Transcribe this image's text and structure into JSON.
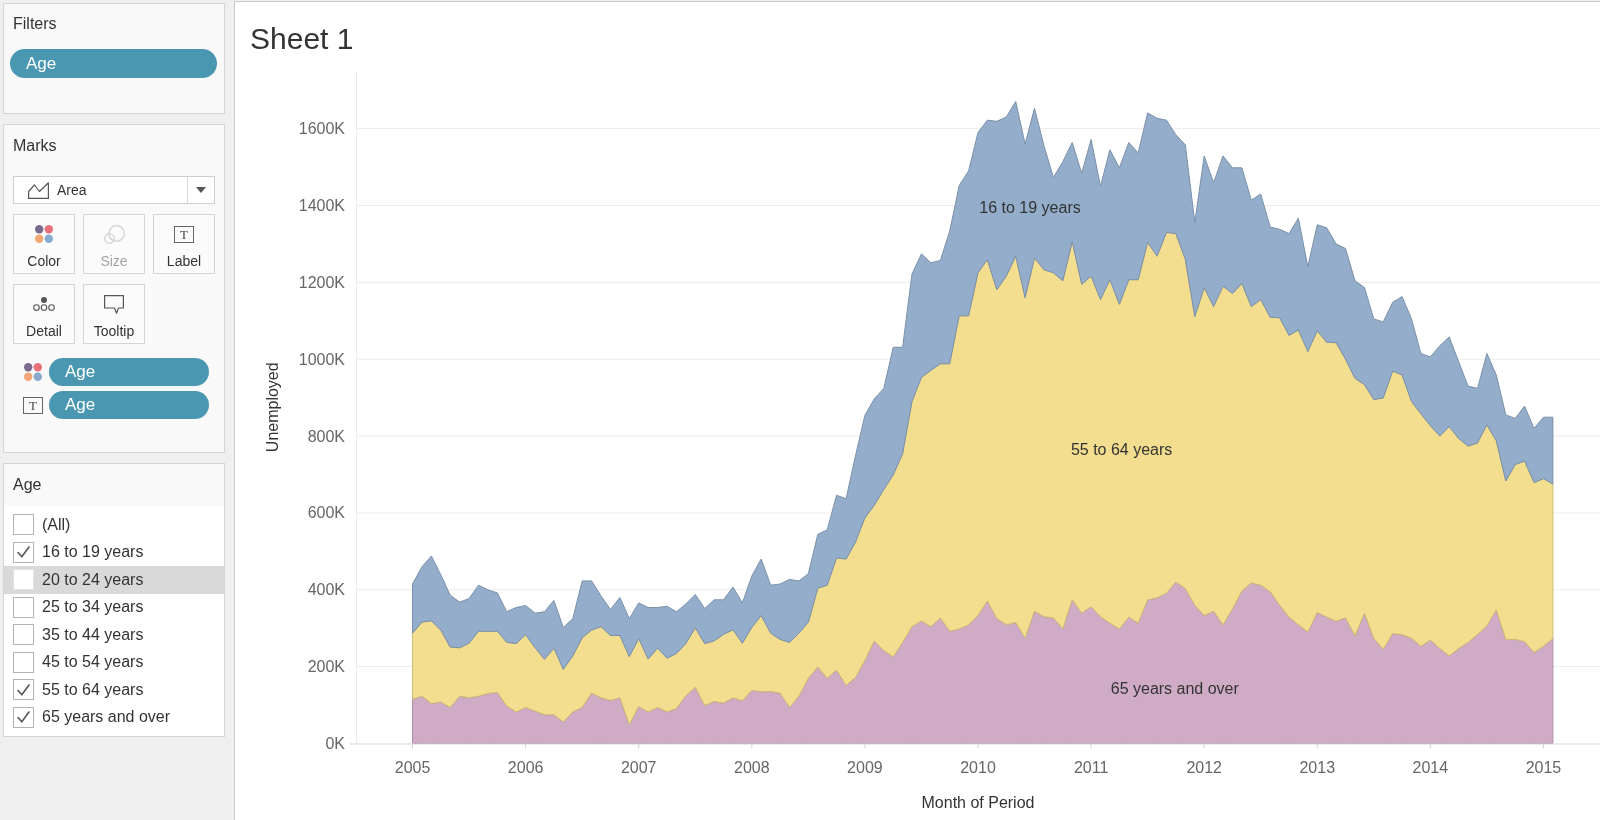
{
  "filters": {
    "title": "Filters",
    "pills": [
      {
        "label": "Age"
      }
    ]
  },
  "marks": {
    "title": "Marks",
    "mark_type": {
      "label": "Area"
    },
    "cards": [
      {
        "kind": "color",
        "label": "Color",
        "disabled": false
      },
      {
        "kind": "size",
        "label": "Size",
        "disabled": true
      },
      {
        "kind": "label",
        "label": "Label",
        "glyph": "T",
        "disabled": false
      },
      {
        "kind": "detail",
        "label": "Detail",
        "disabled": false
      },
      {
        "kind": "tooltip",
        "label": "Tooltip",
        "disabled": false
      }
    ],
    "fields": [
      {
        "kind": "color",
        "label": "Age"
      },
      {
        "kind": "label",
        "glyph": "T",
        "label": "Age"
      }
    ]
  },
  "age_filter": {
    "title": "Age",
    "items": [
      {
        "label": "(All)",
        "checked": false,
        "highlighted": false
      },
      {
        "label": "16 to 19 years",
        "checked": true,
        "highlighted": false
      },
      {
        "label": "20 to 24 years",
        "checked": false,
        "highlighted": true
      },
      {
        "label": "25 to 34 years",
        "checked": false,
        "highlighted": false
      },
      {
        "label": "35 to 44 years",
        "checked": false,
        "highlighted": false
      },
      {
        "label": "45 to 54 years",
        "checked": false,
        "highlighted": false
      },
      {
        "label": "55 to 64 years",
        "checked": true,
        "highlighted": false
      },
      {
        "label": "65 years and over",
        "checked": true,
        "highlighted": false
      }
    ]
  },
  "sheet": {
    "title": "Sheet 1",
    "chart_data": {
      "type": "area",
      "stacked": true,
      "grid": true,
      "xlabel": "Month of Period",
      "ylabel": "Unemployed",
      "x": [
        "2005-01",
        "2005-02",
        "2005-03",
        "2005-04",
        "2005-05",
        "2005-06",
        "2005-07",
        "2005-08",
        "2005-09",
        "2005-10",
        "2005-11",
        "2005-12",
        "2006-01",
        "2006-02",
        "2006-03",
        "2006-04",
        "2006-05",
        "2006-06",
        "2006-07",
        "2006-08",
        "2006-09",
        "2006-10",
        "2006-11",
        "2006-12",
        "2007-01",
        "2007-02",
        "2007-03",
        "2007-04",
        "2007-05",
        "2007-06",
        "2007-07",
        "2007-08",
        "2007-09",
        "2007-10",
        "2007-11",
        "2007-12",
        "2008-01",
        "2008-02",
        "2008-03",
        "2008-04",
        "2008-05",
        "2008-06",
        "2008-07",
        "2008-08",
        "2008-09",
        "2008-10",
        "2008-11",
        "2008-12",
        "2009-01",
        "2009-02",
        "2009-03",
        "2009-04",
        "2009-05",
        "2009-06",
        "2009-07",
        "2009-08",
        "2009-09",
        "2009-10",
        "2009-11",
        "2009-12",
        "2010-01",
        "2010-02",
        "2010-03",
        "2010-04",
        "2010-05",
        "2010-06",
        "2010-07",
        "2010-08",
        "2010-09",
        "2010-10",
        "2010-11",
        "2010-12",
        "2011-01",
        "2011-02",
        "2011-03",
        "2011-04",
        "2011-05",
        "2011-06",
        "2011-07",
        "2011-08",
        "2011-09",
        "2011-10",
        "2011-11",
        "2011-12",
        "2012-01",
        "2012-02",
        "2012-03",
        "2012-04",
        "2012-05",
        "2012-06",
        "2012-07",
        "2012-08",
        "2012-09",
        "2012-10",
        "2012-11",
        "2012-12",
        "2013-01",
        "2013-02",
        "2013-03",
        "2013-04",
        "2013-05",
        "2013-06",
        "2013-07",
        "2013-08",
        "2013-09",
        "2013-10",
        "2013-11",
        "2013-12",
        "2014-01",
        "2014-02",
        "2014-03",
        "2014-04",
        "2014-05",
        "2014-06",
        "2014-07",
        "2014-08",
        "2014-09",
        "2014-10",
        "2014-11",
        "2014-12",
        "2015-01",
        "2015-02"
      ],
      "xlim": [
        "2004-07",
        "2015-07"
      ],
      "ylim": [
        0,
        1750
      ],
      "xticks": [
        {
          "value": "2005-01",
          "label": "2005"
        },
        {
          "value": "2006-01",
          "label": "2006"
        },
        {
          "value": "2007-01",
          "label": "2007"
        },
        {
          "value": "2008-01",
          "label": "2008"
        },
        {
          "value": "2009-01",
          "label": "2009"
        },
        {
          "value": "2010-01",
          "label": "2010"
        },
        {
          "value": "2011-01",
          "label": "2011"
        },
        {
          "value": "2012-01",
          "label": "2012"
        },
        {
          "value": "2013-01",
          "label": "2013"
        },
        {
          "value": "2014-01",
          "label": "2014"
        },
        {
          "value": "2015-01",
          "label": "2015"
        }
      ],
      "yticks": [
        {
          "value": 0,
          "label": "0K"
        },
        {
          "value": 200,
          "label": "200K"
        },
        {
          "value": 400,
          "label": "400K"
        },
        {
          "value": 600,
          "label": "600K"
        },
        {
          "value": 800,
          "label": "800K"
        },
        {
          "value": 1000,
          "label": "1000K"
        },
        {
          "value": 1200,
          "label": "1200K"
        },
        {
          "value": 1400,
          "label": "1400K"
        },
        {
          "value": 1600,
          "label": "1600K"
        }
      ],
      "series": [
        {
          "name": "65 years and over",
          "color": "#cfabc6",
          "values": [
            115,
            123,
            104,
            108,
            94,
            123,
            119,
            123,
            130,
            133,
            97,
            82,
            94,
            84,
            75,
            75,
            56,
            82,
            94,
            131,
            119,
            112,
            119,
            49,
            96,
            82,
            94,
            82,
            91,
            124,
            146,
            99,
            109,
            105,
            119,
            111,
            138,
            135,
            135,
            131,
            94,
            123,
            170,
            199,
            170,
            191,
            151,
            172,
            216,
            267,
            242,
            225,
            263,
            304,
            319,
            304,
            327,
            292,
            298,
            309,
            333,
            371,
            325,
            309,
            315,
            274,
            344,
            330,
            327,
            298,
            374,
            339,
            356,
            330,
            313,
            298,
            329,
            313,
            374,
            379,
            391,
            420,
            403,
            360,
            333,
            344,
            309,
            350,
            397,
            418,
            412,
            395,
            360,
            329,
            309,
            290,
            341,
            329,
            318,
            327,
            280,
            339,
            274,
            245,
            286,
            283,
            274,
            253,
            269,
            247,
            228,
            247,
            263,
            283,
            306,
            348,
            271,
            271,
            265,
            237,
            253,
            273
          ]
        },
        {
          "name": "55 to 64 years",
          "color": "#f3dd8e",
          "values": [
            172,
            193,
            215,
            187,
            157,
            126,
            142,
            169,
            162,
            159,
            166,
            178,
            189,
            165,
            144,
            173,
            137,
            146,
            181,
            164,
            185,
            169,
            162,
            177,
            177,
            138,
            154,
            140,
            143,
            136,
            155,
            161,
            158,
            179,
            177,
            150,
            164,
            198,
            152,
            140,
            169,
            164,
            146,
            205,
            242,
            292,
            329,
            352,
            371,
            353,
            419,
            474,
            491,
            586,
            634,
            667,
            661,
            696,
            815,
            804,
            892,
            888,
            856,
            907,
            953,
            886,
            919,
            903,
            898,
            906,
            932,
            856,
            860,
            825,
            894,
            845,
            878,
            894,
            930,
            889,
            939,
            907,
            857,
            751,
            853,
            793,
            881,
            821,
            800,
            719,
            743,
            714,
            748,
            733,
            767,
            730,
            733,
            715,
            725,
            673,
            670,
            595,
            621,
            654,
            683,
            676,
            616,
            605,
            558,
            553,
            597,
            547,
            511,
            499,
            523,
            440,
            412,
            455,
            470,
            442,
            436,
            402
          ]
        },
        {
          "name": "16 to 19 years",
          "color": "#93adca",
          "values": [
            128,
            144,
            169,
            144,
            135,
            119,
            116,
            120,
            108,
            100,
            80,
            94,
            76,
            90,
            124,
            124,
            109,
            97,
            148,
            128,
            80,
            68,
            99,
            99,
            93,
            134,
            106,
            135,
            109,
            103,
            87,
            91,
            107,
            90,
            111,
            105,
            134,
            147,
            125,
            144,
            164,
            136,
            126,
            140,
            144,
            163,
            157,
            225,
            267,
            277,
            263,
            332,
            277,
            332,
            321,
            280,
            269,
            345,
            339,
            377,
            365,
            363,
            438,
            414,
            403,
            400,
            390,
            322,
            248,
            310,
            258,
            289,
            356,
            295,
            338,
            355,
            357,
            330,
            337,
            359,
            292,
            257,
            298,
            245,
            343,
            322,
            339,
            327,
            301,
            277,
            275,
            235,
            230,
            265,
            291,
            221,
            276,
            298,
            257,
            288,
            254,
            253,
            210,
            198,
            179,
            204,
            215,
            157,
            179,
            235,
            233,
            200,
            156,
            142,
            186,
            171,
            172,
            120,
            143,
            141,
            160,
            174
          ]
        }
      ]
    }
  }
}
